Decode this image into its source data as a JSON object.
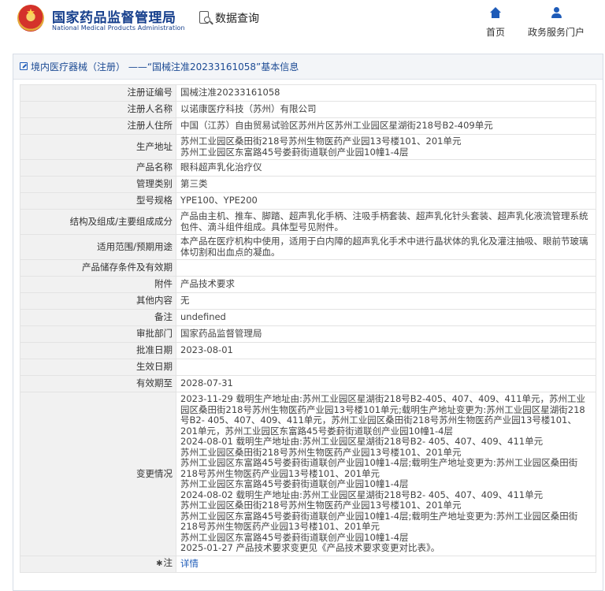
{
  "header": {
    "org_cn": "国家药品监督管理局",
    "org_en": "National Medical Products Administration",
    "query_label": "数据查询",
    "nav": {
      "home_label": "首页",
      "gov_label": "政务服务门户"
    }
  },
  "panel": {
    "title": "境内医疗器械（注册） ——“国械注准20233161058”基本信息"
  },
  "rows": [
    {
      "label": "注册证编号",
      "value": "国械注准20233161058"
    },
    {
      "label": "注册人名称",
      "value": "以诺康医疗科技（苏州）有限公司"
    },
    {
      "label": "注册人住所",
      "value": "中国（江苏）自由贸易试验区苏州片区苏州工业园区星湖街218号B2-409单元"
    },
    {
      "label": "生产地址",
      "value": "苏州工业园区桑田街218号苏州生物医药产业园13号楼101、201单元\n苏州工业园区东富路45号娄葑街道联创产业园10幢1-4层"
    },
    {
      "label": "产品名称",
      "value": "眼科超声乳化治疗仪"
    },
    {
      "label": "管理类别",
      "value": "第三类"
    },
    {
      "label": "型号规格",
      "value": "YPE100、YPE200"
    },
    {
      "label": "结构及组成/主要组成成分",
      "value": "产品由主机、推车、脚踏、超声乳化手柄、注吸手柄套装、超声乳化针头套装、超声乳化液流管理系统包件、滴斗组件组成。具体型号见附件。"
    },
    {
      "label": "适用范围/预期用途",
      "value": "本产品在医疗机构中使用，适用于白内障的超声乳化手术中进行晶状体的乳化及灌注抽吸、眼前节玻璃体切割和出血点的凝血。"
    },
    {
      "label": "产品储存条件及有效期",
      "value": ""
    },
    {
      "label": "附件",
      "value": "产品技术要求"
    },
    {
      "label": "其他内容",
      "value": "无"
    },
    {
      "label": "备注",
      "value": "undefined"
    },
    {
      "label": "审批部门",
      "value": "国家药品监督管理局"
    },
    {
      "label": "批准日期",
      "value": "2023-08-01"
    },
    {
      "label": "生效日期",
      "value": ""
    },
    {
      "label": "有效期至",
      "value": "2028-07-31"
    },
    {
      "label": "变更情况",
      "value": "2023-11-29 载明生产地址由:苏州工业园区星湖街218号B2-405、407、409、411单元，苏州工业园区桑田街218号苏州生物医药产业园13号楼101单元;载明生产地址变更为:苏州工业园区星湖街218号B2- 405、407、409、411单元，苏州工业园区桑田街218号苏州生物医药产业园13号楼101、201单元，苏州工业园区东富路45号娄葑街道联创产业园10幢1-4层\n2024-08-01 载明生产地址由:苏州工业园区星湖街218号B2- 405、407、409、411单元\n苏州工业园区桑田街218号苏州生物医药产业园13号楼101、201单元\n苏州工业园区东富路45号娄葑街道联创产业园10幢1-4层;载明生产地址变更为:苏州工业园区桑田街218号苏州生物医药产业园13号楼101、201单元\n苏州工业园区东富路45号娄葑街道联创产业园10幢1-4层\n2024-08-02 载明生产地址由:苏州工业园区星湖街218号B2- 405、407、409、411单元\n苏州工业园区桑田街218号苏州生物医药产业园13号楼101、201单元\n苏州工业园区东富路45号娄葑街道联创产业园10幢1-4层;载明生产地址变更为:苏州工业园区桑田街218号苏州生物医药产业园13号楼101、201单元\n苏州工业园区东富路45号娄葑街道联创产业园10幢1-4层\n2025-01-27 产品技术要求变更见《产品技术要求变更对比表》。"
    }
  ],
  "note_row": {
    "label": "注",
    "link_text": "详情"
  }
}
